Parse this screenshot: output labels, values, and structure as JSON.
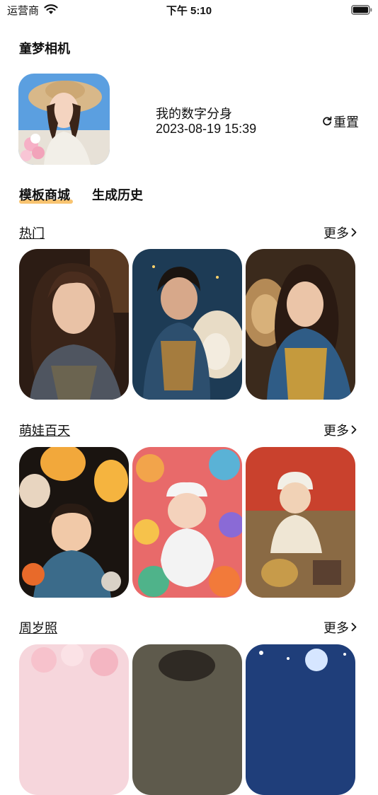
{
  "status_bar": {
    "carrier": "运营商",
    "time": "下午 5:10"
  },
  "header": {
    "title": "童梦相机"
  },
  "profile": {
    "name": "我的数字分身",
    "timestamp": "2023-08-19 15:39",
    "reset_label": "重置"
  },
  "tabs": [
    {
      "label": "模板商城",
      "active": true
    },
    {
      "label": "生成历史",
      "active": false
    }
  ],
  "sections": [
    {
      "title": "热门",
      "more_label": "更多"
    },
    {
      "title": "萌娃百天",
      "more_label": "更多"
    },
    {
      "title": "周岁照",
      "more_label": "更多"
    }
  ],
  "colors": {
    "accent": "#f8c471",
    "text": "#111111"
  }
}
